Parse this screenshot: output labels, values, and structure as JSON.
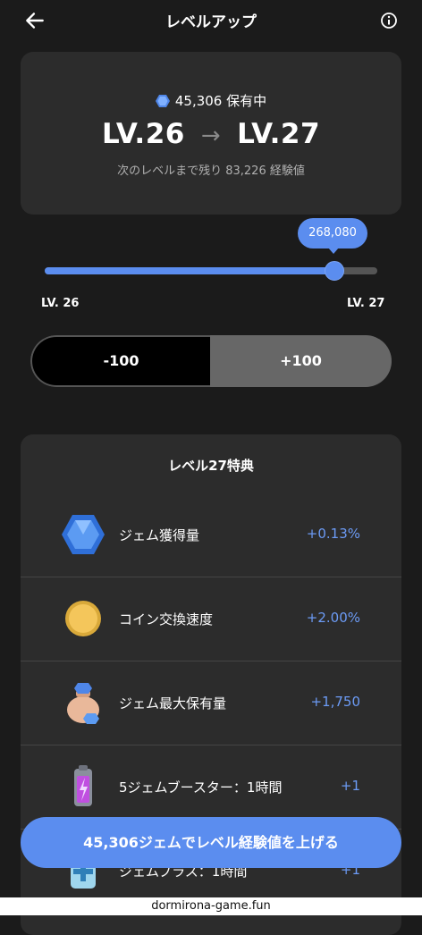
{
  "header": {
    "title": "レベルアップ",
    "back_icon": "arrow-left-icon",
    "info_icon": "info-circle-icon"
  },
  "summary": {
    "gems_owned": "45,306 保有中",
    "current_level": "LV.26",
    "arrow": "→",
    "next_level": "LV.27",
    "remaining": "次のレベルまで残り 83,226 経験値"
  },
  "slider": {
    "value_label": "268,080",
    "progress": 0.87,
    "min_label": "LV. 26",
    "max_label": "LV. 27"
  },
  "stepper": {
    "minus_label": "-100",
    "plus_label": "+100"
  },
  "benefits": {
    "title": "レベル27特典",
    "items": [
      {
        "icon": "gem-icon",
        "label": "ジェム獲得量",
        "value": "+0.13%"
      },
      {
        "icon": "coin-icon",
        "label": "コイン交換速度",
        "value": "+2.00%"
      },
      {
        "icon": "gem-bag-icon",
        "label": "ジェム最大保有量",
        "value": "+1,750"
      },
      {
        "icon": "battery-booster-icon",
        "label": "5ジェムブースター：1時間",
        "value": "+1"
      },
      {
        "icon": "gem-plus-icon",
        "label": "ジェムプラス：1時間",
        "value": "+1"
      }
    ]
  },
  "cta": {
    "label": "45,306ジェムでレベル経験値を上げる"
  },
  "footer": {
    "text": "dormirona-game.fun"
  },
  "colors": {
    "accent": "#5b8def",
    "background": "#1b1b1b",
    "card": "#2c2c2c",
    "value_blue": "#6c9bf5"
  }
}
